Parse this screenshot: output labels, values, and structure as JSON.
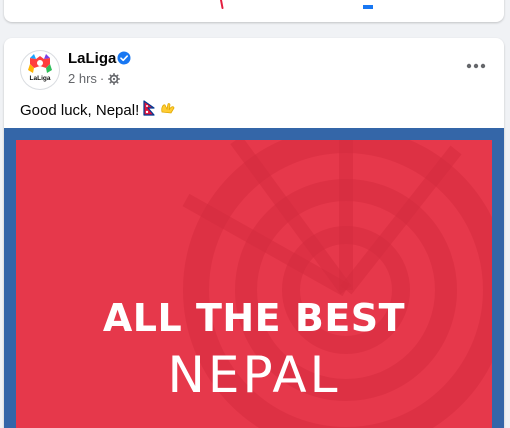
{
  "post": {
    "author": "LaLiga",
    "avatar_text": "LaLiga",
    "time": "2 hrs",
    "separator": "·",
    "text": "Good luck, Nepal!",
    "icons": {
      "verified": "verified-badge-icon",
      "audience": "gear-icon",
      "more": "more-options-icon",
      "flag": "nepal-flag-emoji",
      "hands": "raised-hands-emoji"
    },
    "image": {
      "headline": "ALL THE BEST",
      "subline": "NEPAL"
    }
  },
  "colors": {
    "accent": "#1877f2",
    "image_background": "#3466a8",
    "image_panel": "#e63246"
  }
}
